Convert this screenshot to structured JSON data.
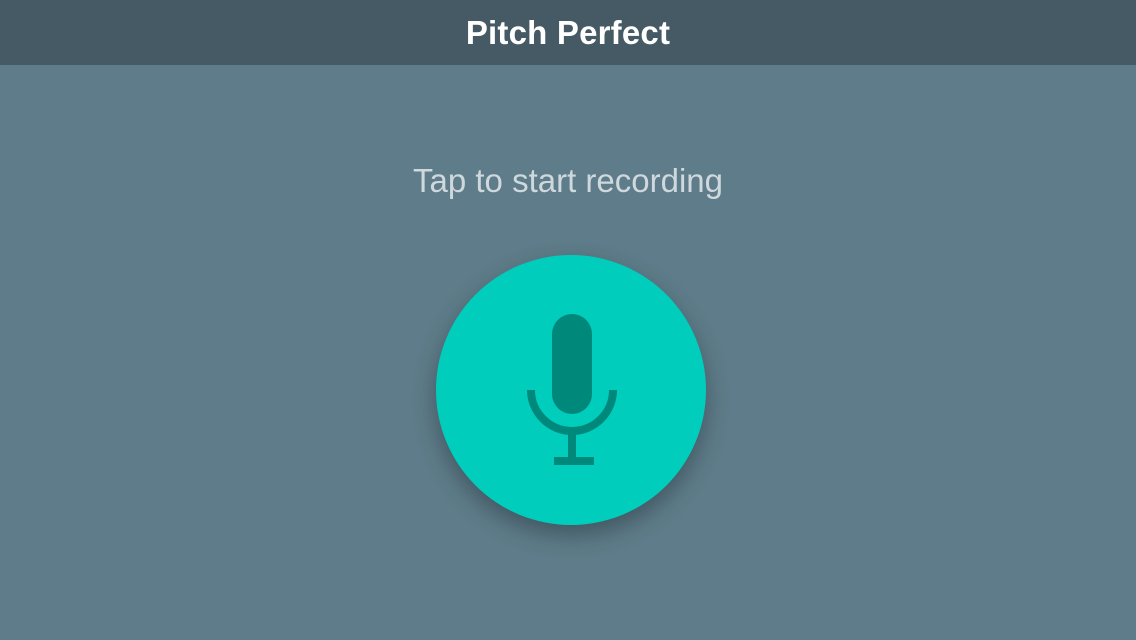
{
  "nav": {
    "title": "Pitch Perfect"
  },
  "main": {
    "prompt": "Tap to start recording",
    "record_button": {
      "icon": "microphone-icon",
      "color": "#00cdbc",
      "icon_color": "#00897b"
    }
  },
  "colors": {
    "background": "#5e7c89",
    "nav_bar": "#455a64",
    "title_text": "#ffffff",
    "prompt_text": "#cfd8dc"
  }
}
